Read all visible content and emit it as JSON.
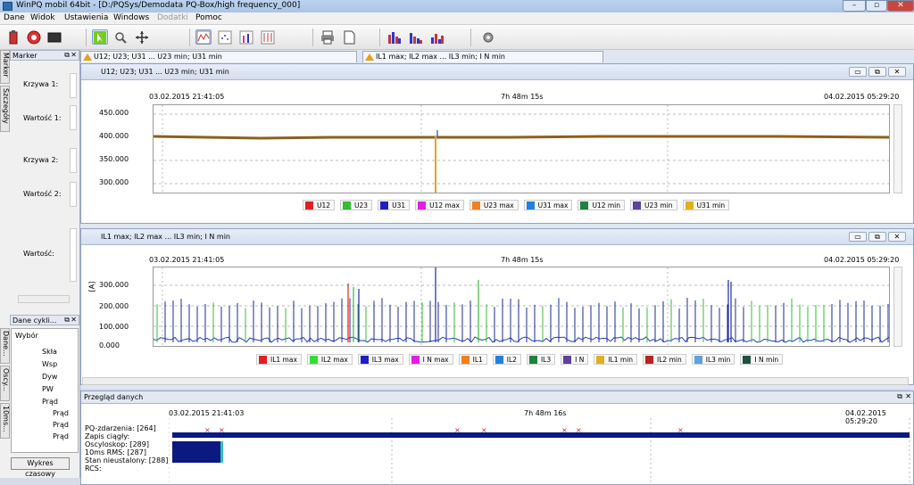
{
  "window": {
    "title": "WinPQ mobil 64bit - [D:/PQSys/Demodata PQ-Box/high frequency_000]"
  },
  "menu": [
    "Dane",
    "Widok",
    "Ustawienia",
    "Windows",
    "Dodatki",
    "Pomoc"
  ],
  "left": {
    "vtabs": [
      "Marker",
      "Szczegóły"
    ],
    "marker_title": "Marker",
    "labels": [
      "Krzywa 1:",
      "Wartość 1:",
      "Krzywa 2:",
      "Wartość 2:",
      "Wartość:"
    ],
    "data_title": "Dane cykli...",
    "vtabs2": [
      "Dane...",
      "Oscy...",
      "10ms..."
    ],
    "tree_header": "Wybór",
    "tree": [
      "Skła",
      "Wsp",
      "Dyw",
      "PW",
      "Prąd",
      "Prąd",
      "Prąd",
      "Prąd"
    ],
    "button": "Wykres czasowy"
  },
  "tabs": [
    {
      "label": "U12; U23; U31 ... U23 min; U31 min"
    },
    {
      "label": "IL1 max; IL2 max ... IL3 min; I N min"
    }
  ],
  "chart1": {
    "header": "U12; U23; U31 ... U23 min; U31 min",
    "start": "03.02.2015 21:41:05",
    "duration": "7h 48m 15s",
    "end": "04.02.2015 05:29:20",
    "yticks": [
      "450.000",
      "400.000",
      "350.000",
      "300.000"
    ],
    "legend": [
      {
        "name": "U12",
        "color": "#e02020"
      },
      {
        "name": "U23",
        "color": "#30c030"
      },
      {
        "name": "U31",
        "color": "#2020c0"
      },
      {
        "name": "U12 max",
        "color": "#e020e0"
      },
      {
        "name": "U23 max",
        "color": "#f08020"
      },
      {
        "name": "U31 max",
        "color": "#2080e0"
      },
      {
        "name": "U12 min",
        "color": "#208040"
      },
      {
        "name": "U23 min",
        "color": "#6040a0"
      },
      {
        "name": "U31 min",
        "color": "#e0b020"
      }
    ]
  },
  "chart2": {
    "header": "IL1 max; IL2 max ... IL3 min; I N min",
    "start": "03.02.2015 21:41:05",
    "duration": "7h 48m 15s",
    "end": "04.02.2015 05:29:20",
    "yunit": "[A]",
    "yticks": [
      "300.000",
      "200.000",
      "100.000",
      "0.000"
    ],
    "legend": [
      {
        "name": "IL1 max",
        "color": "#e02020"
      },
      {
        "name": "IL2 max",
        "color": "#30e030"
      },
      {
        "name": "IL3 max",
        "color": "#2020c0"
      },
      {
        "name": "I N max",
        "color": "#e020e0"
      },
      {
        "name": "IL1",
        "color": "#f08020"
      },
      {
        "name": "IL2",
        "color": "#2080e0"
      },
      {
        "name": "IL3",
        "color": "#208040"
      },
      {
        "name": "I N",
        "color": "#6040a0"
      },
      {
        "name": "IL1 min",
        "color": "#e0b020"
      },
      {
        "name": "IL2 min",
        "color": "#c02020"
      },
      {
        "name": "IL3 min",
        "color": "#60a0e0"
      },
      {
        "name": "I N min",
        "color": "#205040"
      }
    ]
  },
  "overview": {
    "title": "Przegląd danych",
    "start": "03.02.2015 21:41:03",
    "duration": "7h 48m 16s",
    "end": "04.02.2015 05:29:20",
    "rows": [
      "PQ-zdarzenia: [264]",
      "Zapis ciągły:",
      "Oscyloskop: [289]",
      "10ms RMS: [287]",
      "Stan nieustalony: [288]",
      "RCS:"
    ]
  }
}
